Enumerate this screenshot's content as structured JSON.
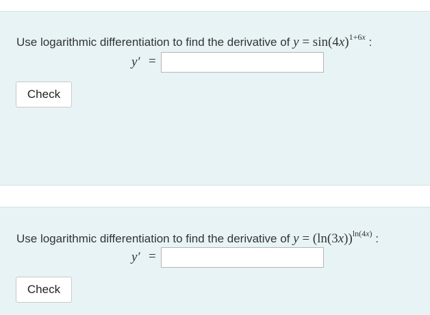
{
  "questions": [
    {
      "prompt": "Use logarithmic differentiation to find the derivative of",
      "expr": {
        "lhs": "y",
        "equals": "=",
        "base_fn": "sin",
        "base_arg": "(4",
        "base_var": "x",
        "base_close": ")",
        "exp_const": "1+6",
        "exp_var": "x"
      },
      "suffix": ":",
      "answer_label": "y′",
      "answer_equals": "=",
      "answer_value": "",
      "answer_placeholder": "",
      "check_label": "Check"
    },
    {
      "prompt": "Use logarithmic differentiation to find the derivative of",
      "expr": {
        "lhs": "y",
        "equals": "=",
        "base_open": "(ln(3",
        "base_var": "x",
        "base_close": "))",
        "exp_fn": "ln(4",
        "exp_var": "x",
        "exp_close": ")"
      },
      "suffix": ":",
      "answer_label": "y′",
      "answer_equals": "=",
      "answer_value": "",
      "answer_placeholder": "",
      "check_label": "Check"
    }
  ]
}
